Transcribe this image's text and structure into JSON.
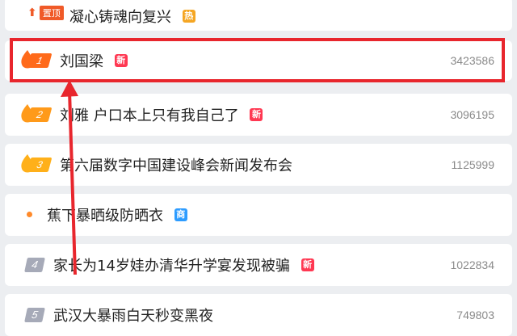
{
  "pinned": {
    "pin_label": "置顶",
    "title": "凝心铸魂向复兴",
    "badge": "热"
  },
  "items": [
    {
      "rank": "1",
      "title": "刘国梁",
      "badge": "新",
      "count": "3423586"
    },
    {
      "rank": "2",
      "title": "刘雅 户口本上只有我自己了",
      "badge": "新",
      "count": "3096195"
    },
    {
      "rank": "3",
      "title": "第六届数字中国建设峰会新闻发布会",
      "badge": "",
      "count": "1125999"
    },
    {
      "rank": "",
      "title": "蕉下暴晒级防晒衣",
      "badge": "商",
      "count": ""
    },
    {
      "rank": "4",
      "title": "家长为14岁娃办清华升学宴发现被骗",
      "badge": "新",
      "count": "1022834"
    },
    {
      "rank": "5",
      "title": "武汉大暴雨白天秒变黑夜",
      "badge": "",
      "count": "749803"
    }
  ],
  "colors": {
    "hot": "#f5a623",
    "new": "#ff3852",
    "ad": "#2d9cff",
    "rank1": "#ff6a1a",
    "rank23": "#ff9a1a",
    "rank45": "#a6aab8",
    "highlight": "#e8262d"
  }
}
